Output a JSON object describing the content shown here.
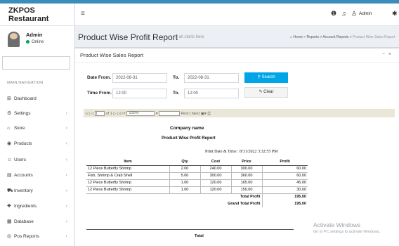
{
  "app": {
    "brand": "ZKPOS Restaurant"
  },
  "user": {
    "name": "Admin",
    "status": "Online"
  },
  "sidebar": {
    "header": "MAIN NAVIGATION",
    "items": [
      {
        "label": "Dashboard",
        "icon": "dashboard-icon",
        "glyph": "⊞"
      },
      {
        "label": "Settings",
        "icon": "gear-icon",
        "glyph": "⚙"
      },
      {
        "label": "Store",
        "icon": "home-icon",
        "glyph": "⌂"
      },
      {
        "label": "Products",
        "icon": "cube-icon",
        "glyph": "◉"
      },
      {
        "label": "Users",
        "icon": "user-icon",
        "glyph": "☺"
      },
      {
        "label": "Accounts",
        "icon": "ledger-icon",
        "glyph": "▤"
      },
      {
        "label": "Inventory",
        "icon": "truck-icon",
        "glyph": "⛟"
      },
      {
        "label": "Ingredients",
        "icon": "plus-icon",
        "glyph": "✚"
      },
      {
        "label": "Database",
        "icon": "database-icon",
        "glyph": "▦"
      },
      {
        "label": "Pos Reports",
        "icon": "eye-icon",
        "glyph": "◎"
      }
    ]
  },
  "header": {
    "admin_label": "Admin"
  },
  "page": {
    "title": "Product Wise Profit Report",
    "subtitle": "it all starts here",
    "breadcrumb": [
      "Home",
      "Reports",
      "Account Reports",
      "Product Wise Sales Report"
    ]
  },
  "box": {
    "title": "Product Wise Sales Report"
  },
  "form": {
    "date_from_label": "Date From.",
    "date_from_value": "2022-08-31",
    "date_to_label": "To.",
    "date_to_value": "2022-08-31",
    "time_from_label": "Time From.",
    "time_from_value": "12:00",
    "time_to_label": "To.",
    "time_to_value": "12:00",
    "search_label": "Search",
    "clear_label": "Clear"
  },
  "viewer": {
    "page_value": "1",
    "of_pages": "of 1",
    "zoom": "100%",
    "find_label": "Find | Next"
  },
  "report": {
    "company": "Company name",
    "title": "Product Wise Profit Report",
    "print_date": "Print Date & Time : 8/31/2022 3:32:55 PM",
    "columns": [
      "Item",
      "Qty",
      "Cost",
      "Price",
      "Profit"
    ],
    "rows": [
      [
        "12 Piece Butterfly Shrimp",
        "2.00",
        "240.00",
        "300.00",
        "60.00"
      ],
      [
        "Fish, Shrimp & Crab Shell",
        "5.00",
        "300.00",
        "360.00",
        "60.00"
      ],
      [
        "12 Piece Butterfly Shrimp",
        "1.00",
        "120.00",
        "165.00",
        "45.00"
      ],
      [
        "12 Piece Butterfly Shrimp",
        "1.00",
        "120.00",
        "150.00",
        "30.00"
      ]
    ],
    "total_profit_label": "Total Profit",
    "total_profit_value": "195.00",
    "grand_total_profit_label": "Grand Total Profit",
    "grand_total_profit_value": "195.00",
    "total_label": "Total"
  },
  "watermark": {
    "title": "Activate Windows",
    "subtitle": "Go to PC settings to activate Windows."
  }
}
